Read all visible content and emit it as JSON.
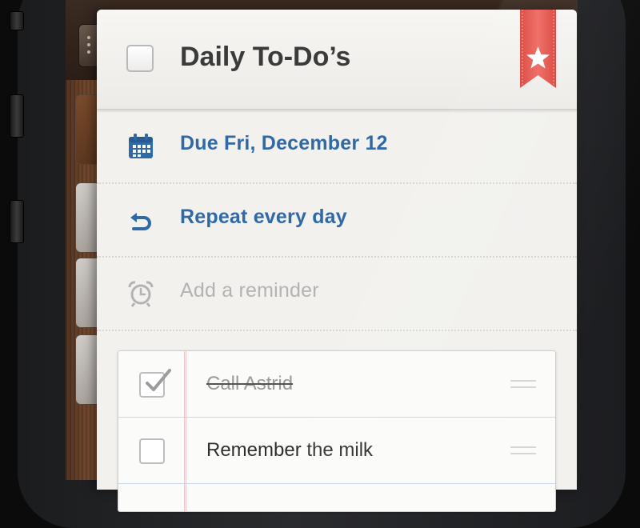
{
  "task": {
    "title": "Daily To-Do’s",
    "completed": false,
    "starred": true
  },
  "details": {
    "due": {
      "label": "Due Fri, December 12",
      "icon": "calendar-icon"
    },
    "repeat": {
      "label": "Repeat every day",
      "icon": "repeat-icon"
    },
    "reminder": {
      "label": "Add a reminder",
      "icon": "alarm-clock-icon"
    }
  },
  "subtasks": [
    {
      "label": "Call Astrid",
      "done": true
    },
    {
      "label": "Remember the milk",
      "done": false
    }
  ],
  "colors": {
    "accent_blue": "#2f69a6",
    "ribbon_red": "#e8554e",
    "muted_text": "#b3b3b3"
  }
}
